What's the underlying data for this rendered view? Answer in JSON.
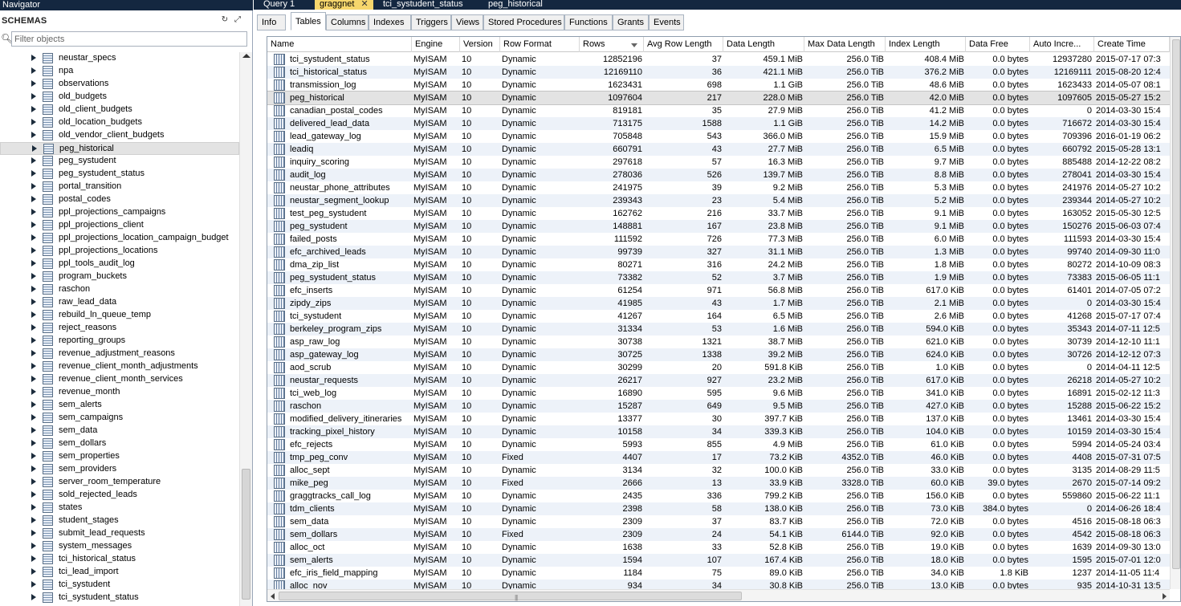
{
  "navigator": {
    "title": "Navigator",
    "schemas_label": "SCHEMAS",
    "filter_placeholder": "Filter objects",
    "selected": "peg_historical",
    "items": [
      "neustar_specs",
      "npa",
      "observations",
      "old_budgets",
      "old_client_budgets",
      "old_location_budgets",
      "old_vendor_client_budgets",
      "peg_historical",
      "peg_systudent",
      "peg_systudent_status",
      "portal_transition",
      "postal_codes",
      "ppl_projections_campaigns",
      "ppl_projections_client",
      "ppl_projections_location_campaign_budget",
      "ppl_projections_locations",
      "ppl_tools_audit_log",
      "program_buckets",
      "raschon",
      "raw_lead_data",
      "rebuild_ln_queue_temp",
      "reject_reasons",
      "reporting_groups",
      "revenue_adjustment_reasons",
      "revenue_client_month_adjustments",
      "revenue_client_month_services",
      "revenue_month",
      "sem_alerts",
      "sem_campaigns",
      "sem_data",
      "sem_dollars",
      "sem_properties",
      "sem_providers",
      "server_room_temperature",
      "sold_rejected_leads",
      "states",
      "student_stages",
      "submit_lead_requests",
      "system_messages",
      "tci_historical_status",
      "tci_lead_import",
      "tci_systudent",
      "tci_systudent_status"
    ]
  },
  "query_tabs": [
    {
      "label": "Query 1",
      "active": false
    },
    {
      "label": "graggnet",
      "active": true
    },
    {
      "label": "tci_systudent_status",
      "active": false
    },
    {
      "label": "peg_historical",
      "active": false
    }
  ],
  "sub_tabs": [
    {
      "label": "Info",
      "active": false
    },
    {
      "label": "Tables",
      "active": true
    },
    {
      "label": "Columns",
      "active": false
    },
    {
      "label": "Indexes",
      "active": false
    },
    {
      "label": "Triggers",
      "active": false
    },
    {
      "label": "Views",
      "active": false
    },
    {
      "label": "Stored Procedures",
      "active": false
    },
    {
      "label": "Functions",
      "active": false
    },
    {
      "label": "Grants",
      "active": false
    },
    {
      "label": "Events",
      "active": false
    }
  ],
  "grid": {
    "columns": [
      "Name",
      "Engine",
      "Version",
      "Row Format",
      "Rows",
      "Avg Row Length",
      "Data Length",
      "Max Data Length",
      "Index Length",
      "Data Free",
      "Auto Incre...",
      "Create Time"
    ],
    "sorted_column": "Rows",
    "selected_row": "peg_historical",
    "rows": [
      [
        "tci_systudent_status",
        "MyISAM",
        "10",
        "Dynamic",
        "12852196",
        "37",
        "459.1 MiB",
        "256.0 TiB",
        "408.4 MiB",
        "0.0 bytes",
        "12937280",
        "2015-07-17 07:3"
      ],
      [
        "tci_historical_status",
        "MyISAM",
        "10",
        "Dynamic",
        "12169110",
        "36",
        "421.1 MiB",
        "256.0 TiB",
        "376.2 MiB",
        "0.0 bytes",
        "12169111",
        "2015-08-20 12:4"
      ],
      [
        "transmission_log",
        "MyISAM",
        "10",
        "Dynamic",
        "1623431",
        "698",
        "1.1 GiB",
        "256.0 TiB",
        "48.6 MiB",
        "0.0 bytes",
        "1623433",
        "2014-05-07 08:1"
      ],
      [
        "peg_historical",
        "MyISAM",
        "10",
        "Dynamic",
        "1097604",
        "217",
        "228.0 MiB",
        "256.0 TiB",
        "42.0 MiB",
        "0.0 bytes",
        "1097605",
        "2015-05-27 15:2"
      ],
      [
        "canadian_postal_codes",
        "MyISAM",
        "10",
        "Dynamic",
        "819181",
        "35",
        "27.9 MiB",
        "256.0 TiB",
        "41.2 MiB",
        "0.0 bytes",
        "0",
        "2014-03-30 15:4"
      ],
      [
        "delivered_lead_data",
        "MyISAM",
        "10",
        "Dynamic",
        "713175",
        "1588",
        "1.1 GiB",
        "256.0 TiB",
        "14.2 MiB",
        "0.0 bytes",
        "716672",
        "2014-03-30 15:4"
      ],
      [
        "lead_gateway_log",
        "MyISAM",
        "10",
        "Dynamic",
        "705848",
        "543",
        "366.0 MiB",
        "256.0 TiB",
        "15.9 MiB",
        "0.0 bytes",
        "709396",
        "2016-01-19 06:2"
      ],
      [
        "leadiq",
        "MyISAM",
        "10",
        "Dynamic",
        "660791",
        "43",
        "27.7 MiB",
        "256.0 TiB",
        "6.5 MiB",
        "0.0 bytes",
        "660792",
        "2015-05-28 13:1"
      ],
      [
        "inquiry_scoring",
        "MyISAM",
        "10",
        "Dynamic",
        "297618",
        "57",
        "16.3 MiB",
        "256.0 TiB",
        "9.7 MiB",
        "0.0 bytes",
        "885488",
        "2014-12-22 08:2"
      ],
      [
        "audit_log",
        "MyISAM",
        "10",
        "Dynamic",
        "278036",
        "526",
        "139.7 MiB",
        "256.0 TiB",
        "8.8 MiB",
        "0.0 bytes",
        "278041",
        "2014-03-30 15:4"
      ],
      [
        "neustar_phone_attributes",
        "MyISAM",
        "10",
        "Dynamic",
        "241975",
        "39",
        "9.2 MiB",
        "256.0 TiB",
        "5.3 MiB",
        "0.0 bytes",
        "241976",
        "2014-05-27 10:2"
      ],
      [
        "neustar_segment_lookup",
        "MyISAM",
        "10",
        "Dynamic",
        "239343",
        "23",
        "5.4 MiB",
        "256.0 TiB",
        "5.2 MiB",
        "0.0 bytes",
        "239344",
        "2014-05-27 10:2"
      ],
      [
        "test_peg_systudent",
        "MyISAM",
        "10",
        "Dynamic",
        "162762",
        "216",
        "33.7 MiB",
        "256.0 TiB",
        "9.1 MiB",
        "0.0 bytes",
        "163052",
        "2015-05-30 12:5"
      ],
      [
        "peg_systudent",
        "MyISAM",
        "10",
        "Dynamic",
        "148881",
        "167",
        "23.8 MiB",
        "256.0 TiB",
        "9.1 MiB",
        "0.0 bytes",
        "150276",
        "2015-06-03 07:4"
      ],
      [
        "failed_posts",
        "MyISAM",
        "10",
        "Dynamic",
        "111592",
        "726",
        "77.3 MiB",
        "256.0 TiB",
        "6.0 MiB",
        "0.0 bytes",
        "111593",
        "2014-03-30 15:4"
      ],
      [
        "efc_archived_leads",
        "MyISAM",
        "10",
        "Dynamic",
        "99739",
        "327",
        "31.1 MiB",
        "256.0 TiB",
        "1.3 MiB",
        "0.0 bytes",
        "99740",
        "2014-09-30 11:0"
      ],
      [
        "dma_zip_list",
        "MyISAM",
        "10",
        "Dynamic",
        "80271",
        "316",
        "24.2 MiB",
        "256.0 TiB",
        "1.8 MiB",
        "0.0 bytes",
        "80272",
        "2014-10-09 08:3"
      ],
      [
        "peg_systudent_status",
        "MyISAM",
        "10",
        "Dynamic",
        "73382",
        "52",
        "3.7 MiB",
        "256.0 TiB",
        "1.9 MiB",
        "0.0 bytes",
        "73383",
        "2015-06-05 11:1"
      ],
      [
        "efc_inserts",
        "MyISAM",
        "10",
        "Dynamic",
        "61254",
        "971",
        "56.8 MiB",
        "256.0 TiB",
        "617.0 KiB",
        "0.0 bytes",
        "61401",
        "2014-07-05 07:2"
      ],
      [
        "zipdy_zips",
        "MyISAM",
        "10",
        "Dynamic",
        "41985",
        "43",
        "1.7 MiB",
        "256.0 TiB",
        "2.1 MiB",
        "0.0 bytes",
        "0",
        "2014-03-30 15:4"
      ],
      [
        "tci_systudent",
        "MyISAM",
        "10",
        "Dynamic",
        "41267",
        "164",
        "6.5 MiB",
        "256.0 TiB",
        "2.6 MiB",
        "0.0 bytes",
        "41268",
        "2015-07-17 07:4"
      ],
      [
        "berkeley_program_zips",
        "MyISAM",
        "10",
        "Dynamic",
        "31334",
        "53",
        "1.6 MiB",
        "256.0 TiB",
        "594.0 KiB",
        "0.0 bytes",
        "35343",
        "2014-07-11 12:5"
      ],
      [
        "asp_raw_log",
        "MyISAM",
        "10",
        "Dynamic",
        "30738",
        "1321",
        "38.7 MiB",
        "256.0 TiB",
        "621.0 KiB",
        "0.0 bytes",
        "30739",
        "2014-12-10 11:1"
      ],
      [
        "asp_gateway_log",
        "MyISAM",
        "10",
        "Dynamic",
        "30725",
        "1338",
        "39.2 MiB",
        "256.0 TiB",
        "624.0 KiB",
        "0.0 bytes",
        "30726",
        "2014-12-12 07:3"
      ],
      [
        "aod_scrub",
        "MyISAM",
        "10",
        "Dynamic",
        "30299",
        "20",
        "591.8 KiB",
        "256.0 TiB",
        "1.0 KiB",
        "0.0 bytes",
        "0",
        "2014-04-11 12:5"
      ],
      [
        "neustar_requests",
        "MyISAM",
        "10",
        "Dynamic",
        "26217",
        "927",
        "23.2 MiB",
        "256.0 TiB",
        "617.0 KiB",
        "0.0 bytes",
        "26218",
        "2014-05-27 10:2"
      ],
      [
        "tci_web_log",
        "MyISAM",
        "10",
        "Dynamic",
        "16890",
        "595",
        "9.6 MiB",
        "256.0 TiB",
        "341.0 KiB",
        "0.0 bytes",
        "16891",
        "2015-02-12 11:3"
      ],
      [
        "raschon",
        "MyISAM",
        "10",
        "Dynamic",
        "15287",
        "649",
        "9.5 MiB",
        "256.0 TiB",
        "427.0 KiB",
        "0.0 bytes",
        "15288",
        "2015-06-22 15:2"
      ],
      [
        "modified_delivery_itineraries",
        "MyISAM",
        "10",
        "Dynamic",
        "13377",
        "30",
        "397.7 KiB",
        "256.0 TiB",
        "137.0 KiB",
        "0.0 bytes",
        "13461",
        "2014-03-30 15:4"
      ],
      [
        "tracking_pixel_history",
        "MyISAM",
        "10",
        "Dynamic",
        "10158",
        "34",
        "339.3 KiB",
        "256.0 TiB",
        "104.0 KiB",
        "0.0 bytes",
        "10159",
        "2014-03-30 15:4"
      ],
      [
        "efc_rejects",
        "MyISAM",
        "10",
        "Dynamic",
        "5993",
        "855",
        "4.9 MiB",
        "256.0 TiB",
        "61.0 KiB",
        "0.0 bytes",
        "5994",
        "2014-05-24 03:4"
      ],
      [
        "tmp_peg_conv",
        "MyISAM",
        "10",
        "Fixed",
        "4407",
        "17",
        "73.2 KiB",
        "4352.0 TiB",
        "46.0 KiB",
        "0.0 bytes",
        "4408",
        "2015-07-31 07:5"
      ],
      [
        "alloc_sept",
        "MyISAM",
        "10",
        "Dynamic",
        "3134",
        "32",
        "100.0 KiB",
        "256.0 TiB",
        "33.0 KiB",
        "0.0 bytes",
        "3135",
        "2014-08-29 11:5"
      ],
      [
        "mike_peg",
        "MyISAM",
        "10",
        "Fixed",
        "2666",
        "13",
        "33.9 KiB",
        "3328.0 TiB",
        "60.0 KiB",
        "39.0 bytes",
        "2670",
        "2015-07-14 09:2"
      ],
      [
        "graggtracks_call_log",
        "MyISAM",
        "10",
        "Dynamic",
        "2435",
        "336",
        "799.2 KiB",
        "256.0 TiB",
        "156.0 KiB",
        "0.0 bytes",
        "559860",
        "2015-06-22 11:1"
      ],
      [
        "tdm_clients",
        "MyISAM",
        "10",
        "Dynamic",
        "2398",
        "58",
        "138.0 KiB",
        "256.0 TiB",
        "73.0 KiB",
        "384.0 bytes",
        "0",
        "2014-06-26 18:4"
      ],
      [
        "sem_data",
        "MyISAM",
        "10",
        "Dynamic",
        "2309",
        "37",
        "83.7 KiB",
        "256.0 TiB",
        "72.0 KiB",
        "0.0 bytes",
        "4516",
        "2015-08-18 06:3"
      ],
      [
        "sem_dollars",
        "MyISAM",
        "10",
        "Fixed",
        "2309",
        "24",
        "54.1 KiB",
        "6144.0 TiB",
        "92.0 KiB",
        "0.0 bytes",
        "4542",
        "2015-08-18 06:3"
      ],
      [
        "alloc_oct",
        "MyISAM",
        "10",
        "Dynamic",
        "1638",
        "33",
        "52.8 KiB",
        "256.0 TiB",
        "19.0 KiB",
        "0.0 bytes",
        "1639",
        "2014-09-30 13:0"
      ],
      [
        "sem_alerts",
        "MyISAM",
        "10",
        "Dynamic",
        "1594",
        "107",
        "167.4 KiB",
        "256.0 TiB",
        "18.0 KiB",
        "0.0 bytes",
        "1595",
        "2015-07-01 12:0"
      ],
      [
        "efc_iris_field_mapping",
        "MyISAM",
        "10",
        "Dynamic",
        "1184",
        "75",
        "89.0 KiB",
        "256.0 TiB",
        "34.0 KiB",
        "1.8 KiB",
        "1237",
        "2014-11-05 11:4"
      ],
      [
        "alloc_nov",
        "MyISAM",
        "10",
        "Dynamic",
        "934",
        "34",
        "30.8 KiB",
        "256.0 TiB",
        "13.0 KiB",
        "0.0 bytes",
        "935",
        "2014-10-31 13:5"
      ]
    ]
  }
}
